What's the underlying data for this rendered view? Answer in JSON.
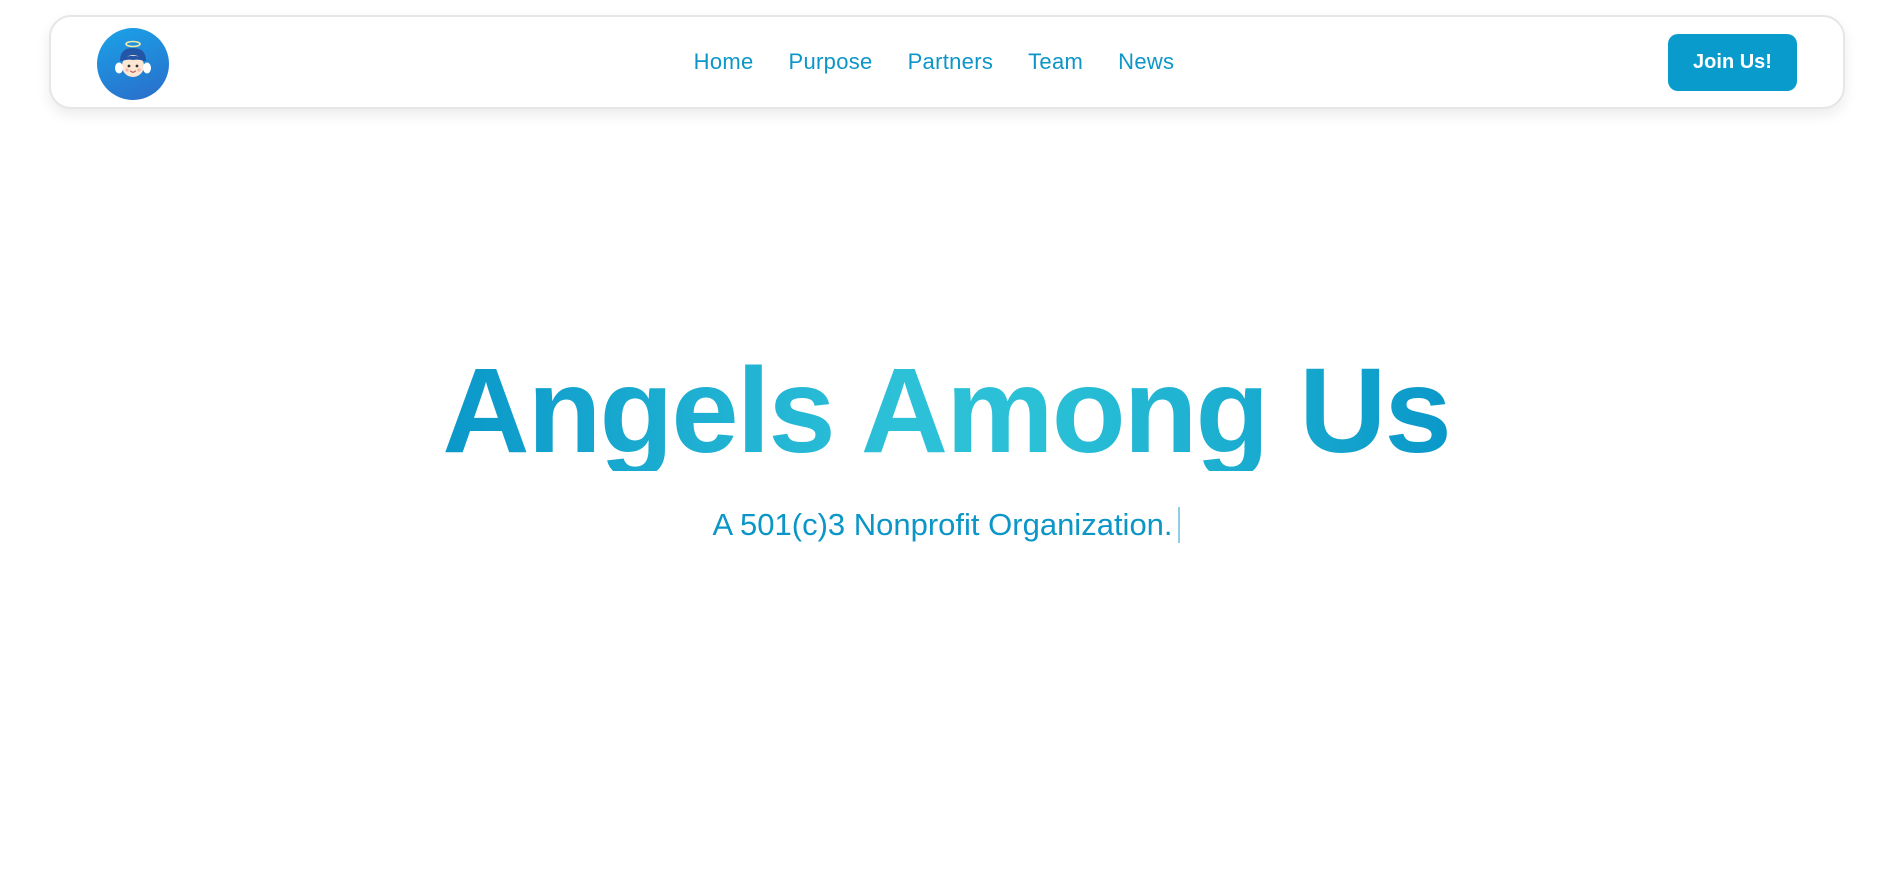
{
  "header": {
    "logo": {
      "icon": "angel-mascot-icon",
      "bg_colors": [
        "#1aa3e8",
        "#2a6cc9"
      ]
    },
    "nav": {
      "links": [
        {
          "label": "Home"
        },
        {
          "label": "Purpose"
        },
        {
          "label": "Partners"
        },
        {
          "label": "Team"
        },
        {
          "label": "News"
        }
      ]
    },
    "cta": {
      "label": "Join Us!"
    }
  },
  "hero": {
    "title": "Angels Among Us",
    "subtitle": "A 501(c)3 Nonprofit Organization."
  },
  "colors": {
    "accent": "#0a9bcd",
    "title_gradient": [
      "#0a98c9",
      "#2dc1d8",
      "#0a98c9"
    ],
    "text": "#0c96c8"
  }
}
